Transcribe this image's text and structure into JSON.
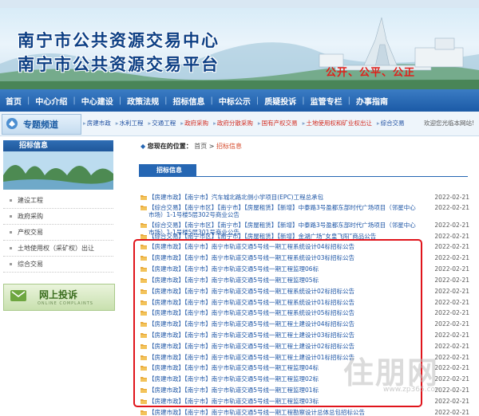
{
  "header": {
    "title_line1": "南宁市公共资源交易中心",
    "title_line2": "南宁市公共资源交易平台",
    "slogan": "公开、公平、公正"
  },
  "nav": [
    "首页",
    "中心介绍",
    "中心建设",
    "政策法规",
    "招标信息",
    "中标公示",
    "质疑投诉",
    "监管专栏",
    "办事指南"
  ],
  "special": {
    "label": "专题频道",
    "links": [
      "房建市政",
      "水利工程",
      "交通工程",
      "政府采购",
      "政府分散采购",
      "国有产权交易",
      "土地使用权和矿业权出让",
      "综合交易"
    ],
    "welcome": "欢迎您光临本网站!"
  },
  "sidebar": {
    "heading": "招标信息",
    "items": [
      "建设工程",
      "政府采购",
      "产权交易",
      "土地使用权（采矿权）出让",
      "综合交易"
    ],
    "complaint_title": "网上投诉",
    "complaint_sub": "ONLINE COMPLAINTS"
  },
  "breadcrumb": {
    "prefix": "您现在的位置：",
    "home": "首页",
    "sep": ">",
    "current": "招标信息"
  },
  "list": {
    "tab_label": "招标信息",
    "items": [
      {
        "text": "【房建市政】【南宁市】汽车城北路北侧小学项目(EPC)工程总承包",
        "date": "2022-02-21"
      },
      {
        "text": "【综合交易】【南宁市区】【南宁市】【房屋租赁】【新增】中泰路3号盈都东部时代广场项目（邻星中心市场）1-1号楼5层302号商业公告",
        "date": "2022-02-21"
      },
      {
        "text": "【综合交易】【南宁市区】【南宁市】【房屋租赁】【新增】中泰路3号盈都东部时代广场项目（邻星中心市场）1-1号楼5层301号商业公告",
        "date": "2022-02-21"
      },
      {
        "text": "【综合交易】【南宁市区】【南宁市】【房屋租赁】【新增】金湖广场“女皇飞阳”商品公告",
        "date": "2022-02-21"
      },
      {
        "text": "【房建市政】【南宁市】南宁市轨道交通5号线一期工程系统设计04标招标公告",
        "date": "2022-02-21"
      },
      {
        "text": "【房建市政】【南宁市】南宁市轨道交通5号线一期工程系统设计03标招标公告",
        "date": "2022-02-21"
      },
      {
        "text": "【房建市政】【南宁市】南宁市轨道交通5号线一期工程监理06标",
        "date": "2022-02-21"
      },
      {
        "text": "【房建市政】【南宁市】南宁市轨道交通5号线一期工程监理05标",
        "date": "2022-02-21"
      },
      {
        "text": "【房建市政】【南宁市】南宁市轨道交通5号线一期工程系统设计02标招标公告",
        "date": "2022-02-21"
      },
      {
        "text": "【房建市政】【南宁市】南宁市轨道交通5号线一期工程系统设计01标招标公告",
        "date": "2022-02-21"
      },
      {
        "text": "【房建市政】【南宁市】南宁市轨道交通5号线一期工程系统设计05标招标公告",
        "date": "2022-02-21"
      },
      {
        "text": "【房建市政】【南宁市】南宁市轨道交通5号线一期工程土建设计04标招标公告",
        "date": "2022-02-21"
      },
      {
        "text": "【房建市政】【南宁市】南宁市轨道交通5号线一期工程土建设计03标招标公告",
        "date": "2022-02-21"
      },
      {
        "text": "【房建市政】【南宁市】南宁市轨道交通5号线一期工程土建设计02标招标公告",
        "date": "2022-02-21"
      },
      {
        "text": "【房建市政】【南宁市】南宁市轨道交通5号线一期工程土建设计01标招标公告",
        "date": "2022-02-21"
      },
      {
        "text": "【房建市政】【南宁市】南宁市轨道交通5号线一期工程监理04标",
        "date": "2022-02-21"
      },
      {
        "text": "【房建市政】【南宁市】南宁市轨道交通5号线一期工程监理02标",
        "date": "2022-02-21"
      },
      {
        "text": "【房建市政】【南宁市】南宁市轨道交通5号线一期工程监理01标",
        "date": "2022-02-21"
      },
      {
        "text": "【房建市政】【南宁市】南宁市轨道交通5号线一期工程监理03标",
        "date": "2022-02-21"
      },
      {
        "text": "【房建市政】【南宁市】南宁市轨道交通5号线一期工程勘察设计总体总包招标公告",
        "date": "2022-02-21"
      }
    ]
  },
  "watermark": "住朋网",
  "watermark_url": "www.zp365.com",
  "colors": {
    "nav_blue": "#1b5aa6",
    "link_blue": "#1e56a6",
    "highlight_red": "#e0141b",
    "slogan_red": "#e0201a"
  }
}
